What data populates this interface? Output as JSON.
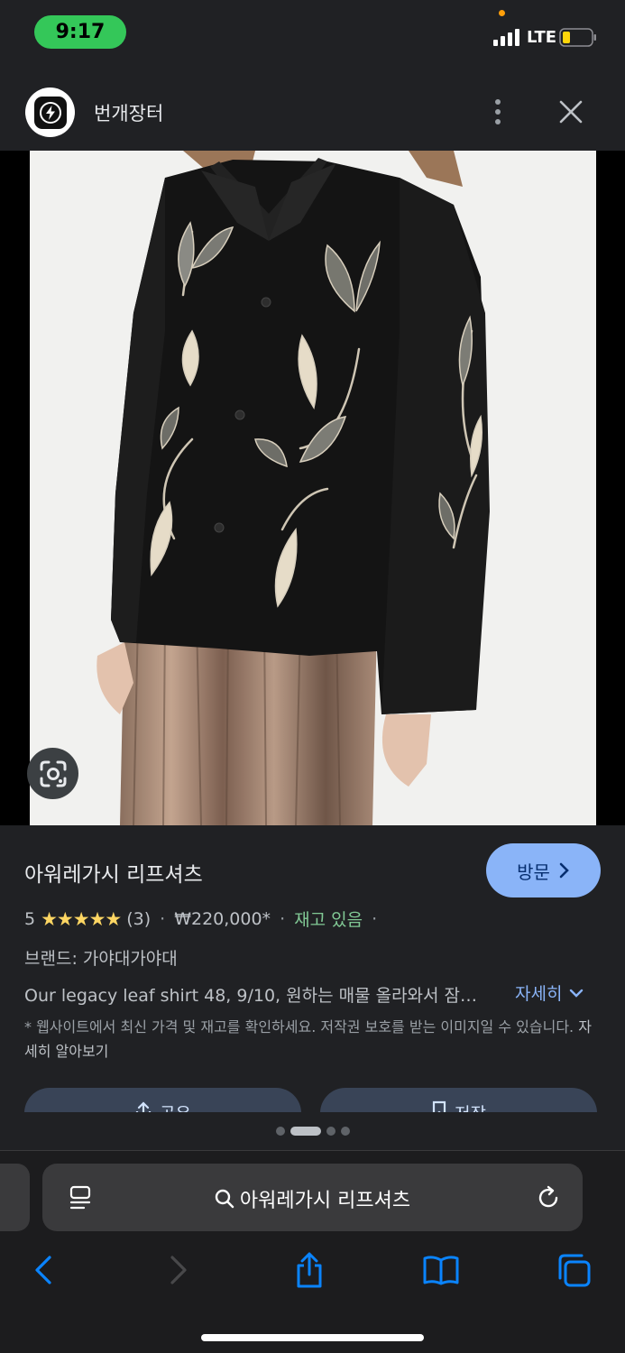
{
  "status_bar": {
    "time": "9:17",
    "network": "LTE",
    "icons": [
      "signal-bars-icon",
      "battery-icon"
    ]
  },
  "header": {
    "site_name": "번개장터",
    "logo_icon": "lightning-bolt-icon",
    "more_icon": "more-vertical-icon",
    "close_icon": "close-icon"
  },
  "image": {
    "lens_icon": "google-lens-icon"
  },
  "product": {
    "title": "아워레가시 리프셔츠",
    "visit_label": "방문",
    "rating_value": "5",
    "stars": "★★★★★",
    "review_count": "(3)",
    "separator": "·",
    "price": "₩220,000*",
    "stock_status": "재고 있음",
    "brand": "브랜드: 가야대가야대",
    "description": "Our legacy leaf shirt 48, 9/10, 원하는 매물 올라와서 잠…",
    "more_label": "자세히",
    "notice": "* 웹사이트에서 최신 가격 및 재고를 확인하세요. 저작권 보호를 받는 이미지일 수 있습니다.",
    "notice_link": "자세히 알아보기",
    "share_label": "공유",
    "save_label": "저장"
  },
  "pager": {
    "count": 4,
    "active_index": 1
  },
  "safari": {
    "url_text": "아워레가시 리프셔츠",
    "toolbar_icons": [
      "back-icon",
      "forward-icon",
      "share-icon",
      "bookmarks-icon",
      "tabs-icon"
    ]
  },
  "colors": {
    "background": "#202124",
    "accent": "#8ab4f8",
    "stock_green": "#81c995",
    "star_yellow": "#fdd663",
    "time_pill": "#34c759",
    "safari_link": "#0a84ff"
  }
}
